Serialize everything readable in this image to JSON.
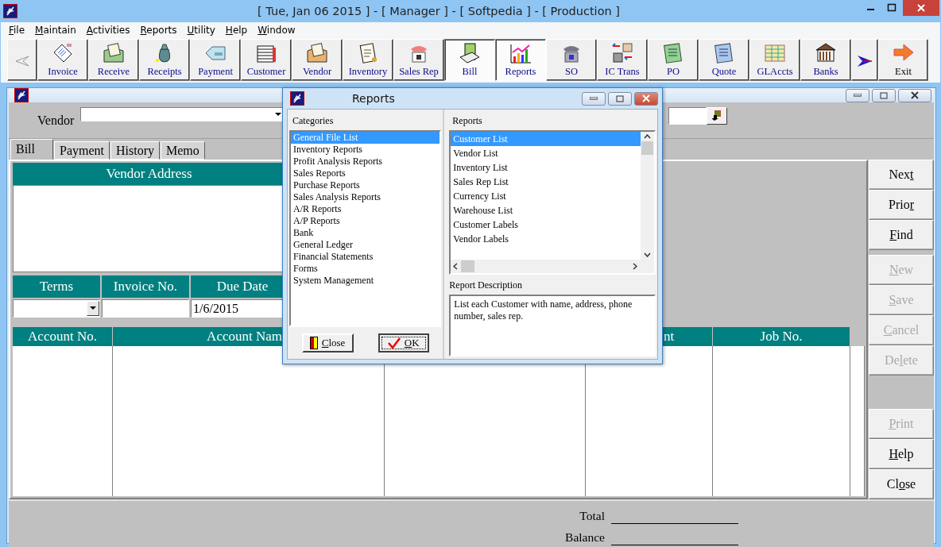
{
  "window": {
    "title": "[ Tue, Jan 06 2015 ] - [ Manager ] - [ Softpedia ] - [ Production ]"
  },
  "menu": [
    {
      "label": "File"
    },
    {
      "label": "Maintain"
    },
    {
      "label": "Activities"
    },
    {
      "label": "Reports"
    },
    {
      "label": "Utility"
    },
    {
      "label": "Help"
    },
    {
      "label": "Window"
    }
  ],
  "toolbar": [
    {
      "label": "Invoice",
      "selected": false
    },
    {
      "label": "Receive",
      "selected": false
    },
    {
      "label": "Receipts",
      "selected": false
    },
    {
      "label": "Payment",
      "selected": false
    },
    {
      "label": "Customer",
      "selected": false
    },
    {
      "label": "Vendor",
      "selected": false
    },
    {
      "label": "Inventory",
      "selected": false
    },
    {
      "label": "Sales Rep",
      "selected": false
    },
    {
      "label": "Bill",
      "selected": true
    },
    {
      "label": "Reports",
      "selected": true
    },
    {
      "label": "SO",
      "selected": false
    },
    {
      "label": "IC Trans",
      "selected": false
    },
    {
      "label": "PO",
      "selected": false
    },
    {
      "label": "Quote",
      "selected": false
    },
    {
      "label": "GLAccts",
      "selected": false
    },
    {
      "label": "Banks",
      "selected": false
    }
  ],
  "exit_button": {
    "label": "Exit"
  },
  "bill_window": {
    "vendor_label": "Vendor",
    "tabs": [
      {
        "label": "Bill",
        "selected": true
      },
      {
        "label": "Payment",
        "selected": false
      },
      {
        "label": "History",
        "selected": false
      },
      {
        "label": "Memo",
        "selected": false
      }
    ],
    "vendor_address_header": "Vendor Address",
    "fields": [
      {
        "label": "Terms",
        "kind": "dropdown"
      },
      {
        "label": "Invoice No.",
        "kind": "text"
      },
      {
        "label": "Due Date",
        "kind": "text",
        "value": "1/6/2015"
      }
    ],
    "grid_columns": [
      "Account No.",
      "Account Nam",
      "nt",
      "Job No."
    ],
    "button_groups": [
      [
        {
          "label": "Next",
          "disabled": false
        },
        {
          "label": "Prior",
          "disabled": false
        },
        {
          "label": "Find",
          "disabled": false
        }
      ],
      [
        {
          "label": "New",
          "disabled": true
        },
        {
          "label": "Save",
          "disabled": true
        },
        {
          "label": "Cancel",
          "disabled": true
        },
        {
          "label": "Delete",
          "disabled": true
        }
      ],
      [
        {
          "label": "Print",
          "disabled": true
        },
        {
          "label": "Help",
          "disabled": false
        },
        {
          "label": "Close",
          "disabled": false
        }
      ]
    ],
    "totals": [
      {
        "label": "Total"
      },
      {
        "label": "Balance"
      }
    ]
  },
  "reports_dialog": {
    "title": "Reports",
    "categories_label": "Categories",
    "categories": [
      {
        "label": "General File List",
        "selected": true
      },
      {
        "label": "Inventory Reports",
        "selected": false
      },
      {
        "label": "Profit Analysis Reports",
        "selected": false
      },
      {
        "label": "Sales Reports",
        "selected": false
      },
      {
        "label": "Purchase Reports",
        "selected": false
      },
      {
        "label": "Sales Analysis Reports",
        "selected": false
      },
      {
        "label": "A/R Reports",
        "selected": false
      },
      {
        "label": "A/P Reports",
        "selected": false
      },
      {
        "label": "Bank",
        "selected": false
      },
      {
        "label": "General Ledger",
        "selected": false
      },
      {
        "label": "Financial Statements",
        "selected": false
      },
      {
        "label": "Forms",
        "selected": false
      },
      {
        "label": "System Management",
        "selected": false
      }
    ],
    "reports_label": "Reports",
    "reports": [
      {
        "label": "Customer List",
        "selected": true
      },
      {
        "label": "Vendor List",
        "selected": false
      },
      {
        "label": "Inventory List",
        "selected": false
      },
      {
        "label": "Sales Rep List",
        "selected": false
      },
      {
        "label": "Currency List",
        "selected": false
      },
      {
        "label": "Warehouse List",
        "selected": false
      },
      {
        "label": "Customer Labels",
        "selected": false
      },
      {
        "label": "Vendor Labels",
        "selected": false
      }
    ],
    "description_label": "Report Description",
    "description": "List each Customer with name, address, phone number, sales rep.",
    "buttons": [
      {
        "label": "Close",
        "kind": "close"
      },
      {
        "label": "OK",
        "kind": "ok"
      }
    ]
  }
}
